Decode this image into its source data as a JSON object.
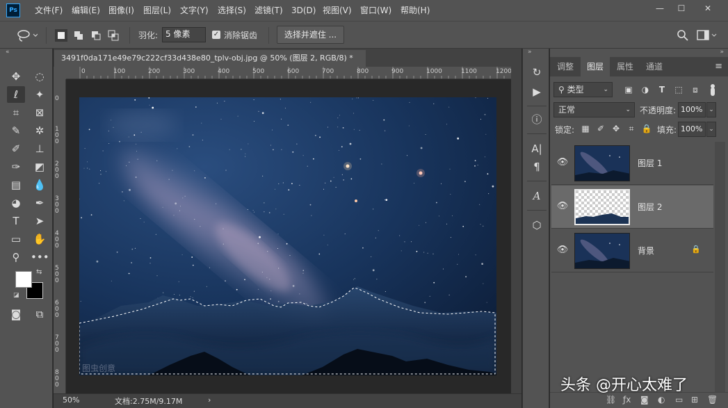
{
  "app": {
    "logo": "Ps"
  },
  "menu": [
    "文件(F)",
    "编辑(E)",
    "图像(I)",
    "图层(L)",
    "文字(Y)",
    "选择(S)",
    "滤镜(T)",
    "3D(D)",
    "视图(V)",
    "窗口(W)",
    "帮助(H)"
  ],
  "options": {
    "feather_label": "羽化:",
    "feather_value": "5 像素",
    "antialias_label": "消除锯齿",
    "antialias_checked": true,
    "select_mask_label": "选择并遮住 ..."
  },
  "document": {
    "tab_title": "3491f0da171e49e79c222cf33d438e80_tplv-obj.jpg @ 50% (图层 2, RGB/8) *",
    "canvas_watermark": "图虫创意"
  },
  "ruler": {
    "top_labels": [
      "0",
      "100",
      "200",
      "300",
      "400",
      "500",
      "600",
      "700",
      "800",
      "900",
      "1000",
      "1100",
      "1200"
    ],
    "left_labels": [
      "0",
      "1 0 0",
      "2 0 0",
      "3 0 0",
      "4 0 0",
      "5 0 0",
      "6 0 0",
      "7 0 0",
      "8 0 0"
    ]
  },
  "status": {
    "zoom": "50%",
    "doc_size": "文档:2.75M/9.17M",
    "arrow": "›"
  },
  "layers_panel": {
    "tabs": [
      "调整",
      "图层",
      "属性",
      "通道"
    ],
    "active_tab": "图层",
    "filter_label": "类型",
    "blend_mode": "正常",
    "opacity_label": "不透明度:",
    "opacity_value": "100%",
    "lock_label": "锁定:",
    "fill_label": "填充:",
    "fill_value": "100%",
    "layers": [
      {
        "name": "图层 1",
        "selected": false,
        "locked": false
      },
      {
        "name": "图层 2",
        "selected": true,
        "locked": false
      },
      {
        "name": "背景",
        "selected": false,
        "locked": true
      }
    ]
  },
  "watermark": "头条 @开心太难了",
  "colors": {
    "chrome": "#535353",
    "panel_dark": "#424242",
    "workspace": "#282828",
    "accent": "#31a8ff",
    "sky_deep": "#0d1a33",
    "sky_mid": "#1f3a63",
    "milky_way": "#b9a4c6"
  }
}
